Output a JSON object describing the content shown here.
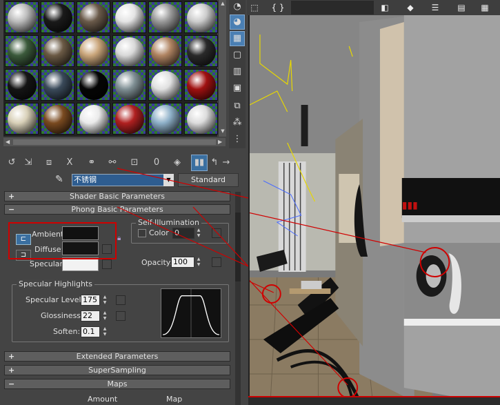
{
  "material_editor": {
    "slots": [
      {
        "color": "#bbbbbb"
      },
      {
        "color": "#1a1a1a"
      },
      {
        "color": "#6a5a4a"
      },
      {
        "color": "#e4e4e4"
      },
      {
        "color": "#999999"
      },
      {
        "color": "#cccccc"
      },
      {
        "color": "#3b5a3b"
      },
      {
        "color": "#6b5a45"
      },
      {
        "color": "#c9a57a"
      },
      {
        "color": "#d8d8d8"
      },
      {
        "color": "#b08462"
      },
      {
        "color": "#2a2a2a"
      },
      {
        "color": "#151515"
      },
      {
        "color": "#3a4a5a"
      },
      {
        "color": "#050505"
      },
      {
        "color": "#7f8f94"
      },
      {
        "color": "#e0e0e0"
      },
      {
        "color": "#a01010"
      },
      {
        "color": "#d8d0b8"
      },
      {
        "color": "#7a4a20"
      },
      {
        "color": "#eaeaea"
      },
      {
        "color": "#b02020"
      },
      {
        "color": "#8eb0c8"
      },
      {
        "color": "#dcdcdc"
      }
    ],
    "toolbar": {
      "get_material_icon": "get-material-icon",
      "put_to_scene_icon": "put-to-scene-icon",
      "assign_icon": "assign-to-selection-icon",
      "reset_label": "X",
      "make_copy_icon": "make-unique-icon",
      "put_library_icon": "put-to-library-icon",
      "effects_channel_label": "0",
      "show_map_icon": "show-map-icon",
      "show_end_icon": "show-end-result-icon",
      "go_parent_icon": "go-to-parent-icon",
      "go_sibling_icon": "go-forward-sibling-icon"
    },
    "material_name": "不锈钢",
    "material_type": "Standard",
    "rollouts": {
      "shader_basic": {
        "sign": "+",
        "title": "Shader Basic Parameters"
      },
      "phong_basic": {
        "sign": "−",
        "title": "Phong Basic Parameters"
      },
      "extended": {
        "sign": "+",
        "title": "Extended Parameters"
      },
      "supersampling": {
        "sign": "+",
        "title": "SuperSampling"
      },
      "maps": {
        "sign": "−",
        "title": "Maps"
      }
    },
    "phong": {
      "ambient_label": "Ambient:",
      "diffuse_label": "Diffuse:",
      "specular_label": "Specular:",
      "ambient_color": "#111111",
      "diffuse_color": "#141414",
      "specular_color": "#f2f2f2",
      "self_illum_title": "Self-Illumination",
      "color_label": "Color",
      "color_value": "0",
      "opacity_label": "Opacity:",
      "opacity_value": "100"
    },
    "specular_highlights": {
      "title": "Specular Highlights",
      "level_label": "Specular Level:",
      "level_value": "175",
      "gloss_label": "Glossiness:",
      "gloss_value": "22",
      "soften_label": "Soften:",
      "soften_value": "0.1"
    },
    "maps_columns": {
      "amount": "Amount",
      "map": "Map"
    }
  },
  "viewport": {
    "toolbar_icons": [
      "select-icon",
      "curly-brace-icon",
      "dropdown",
      "mirror-icon",
      "align-icon",
      "layers-icon",
      "curve-editor-icon",
      "schematic-icon"
    ],
    "highlight_color": "#d00000"
  }
}
